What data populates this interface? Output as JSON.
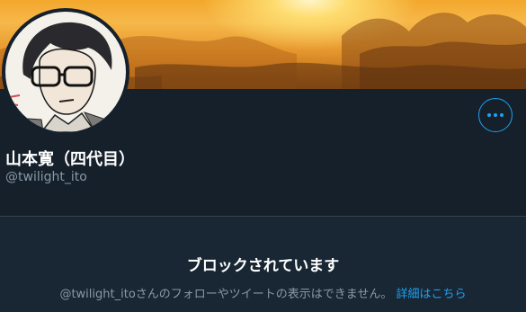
{
  "profile": {
    "display_name": "山本寛（四代目）",
    "handle": "@twilight_ito",
    "more_button_icon": "more-horizontal-icon"
  },
  "blocked": {
    "title": "ブロックされています",
    "description": "@twilight_itoさんのフォローやツイートの表示はできません。",
    "learn_more_label": "詳細はこちら"
  },
  "colors": {
    "background": "#15202b",
    "accent": "#1da1f2",
    "secondary_text": "#8899a6"
  }
}
